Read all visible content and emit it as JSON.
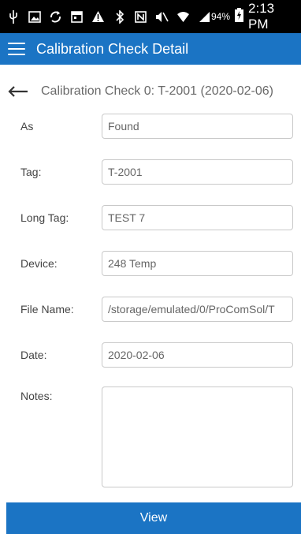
{
  "status_bar": {
    "icons": [
      "usb-icon",
      "image-icon",
      "sync-icon",
      "calendar-icon",
      "warning-icon",
      "bluetooth-icon",
      "nfc-icon",
      "mute-icon",
      "wifi-icon",
      "signal-icon"
    ],
    "battery": "94%",
    "time": "2:13 PM"
  },
  "app_bar": {
    "title": "Calibration Check Detail"
  },
  "subheader": {
    "title": "Calibration Check 0: T-2001  (2020-02-06)"
  },
  "fields": {
    "as": {
      "label": "As",
      "value": "Found"
    },
    "tag": {
      "label": "Tag:",
      "value": "T-2001"
    },
    "long_tag": {
      "label": "Long Tag:",
      "value": "TEST 7"
    },
    "device": {
      "label": "Device:",
      "value": "248 Temp"
    },
    "file_name": {
      "label": "File Name:",
      "value": "/storage/emulated/0/ProComSol/T"
    },
    "date": {
      "label": "Date:",
      "value": "2020-02-06"
    },
    "notes": {
      "label": "Notes:",
      "value": ""
    }
  },
  "actions": {
    "view_label": "View"
  },
  "colors": {
    "accent": "#1b74c4",
    "status_bar": "#000000"
  }
}
